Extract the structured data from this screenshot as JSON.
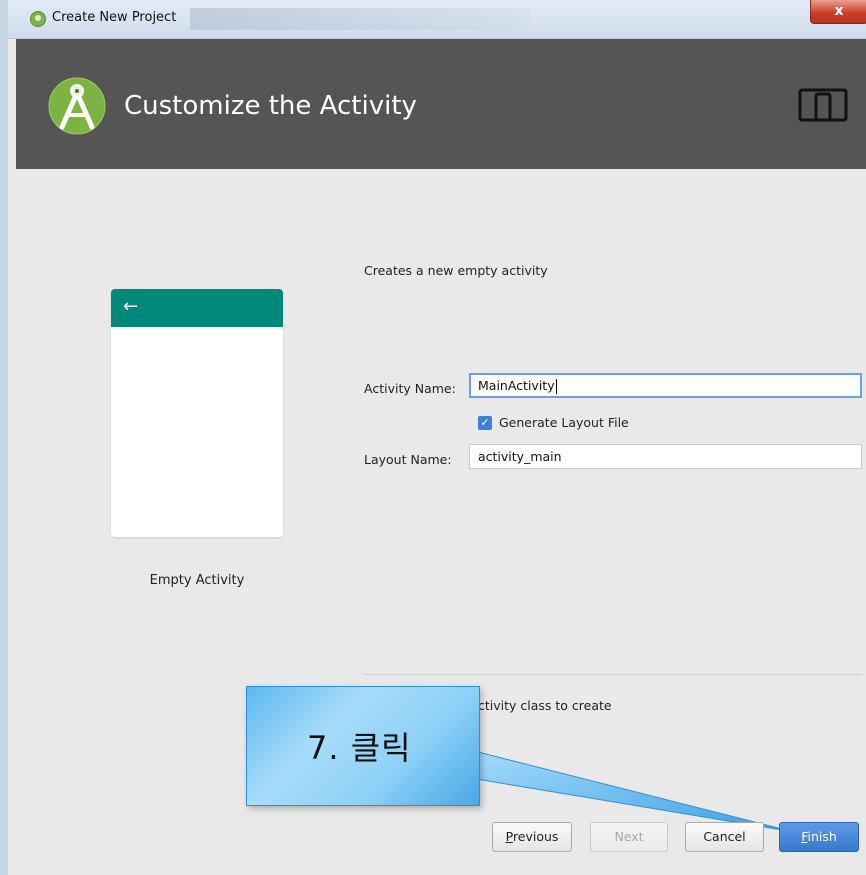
{
  "window": {
    "title": "Create New Project",
    "close_label": "x"
  },
  "header": {
    "title": "Customize the Activity",
    "logo_icon": "android-studio-logo-icon",
    "device_icon": "device-form-factor-icon"
  },
  "preview": {
    "back_icon": "back-arrow-icon",
    "back_glyph": "←",
    "template_name": "Empty Activity",
    "appbar_color": "#00897b"
  },
  "form": {
    "description": "Creates a new empty activity",
    "activity_name_label": "Activity Name:",
    "activity_name_value": "MainActivity",
    "generate_layout_label": "Generate Layout File",
    "generate_layout_checked": true,
    "layout_name_label": "Layout Name:",
    "layout_name_value": "activity_main",
    "hint_text": "ctivity class to create"
  },
  "annotation": {
    "text": "7.  클릭"
  },
  "buttons": {
    "previous": {
      "mnemonic": "P",
      "rest": "revious"
    },
    "next": "Next",
    "cancel": "Cancel",
    "finish": {
      "mnemonic": "F",
      "rest": "inish"
    }
  },
  "colors": {
    "header_bg": "#555555",
    "accent": "#3d7fd9",
    "callout": "#8fd1f7"
  }
}
